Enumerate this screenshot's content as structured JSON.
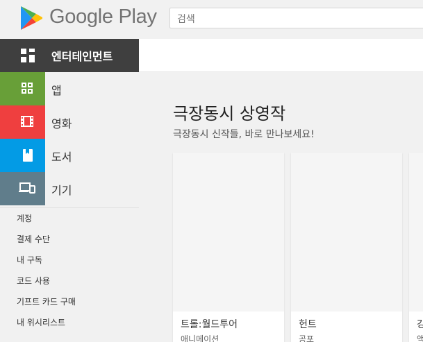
{
  "header": {
    "logo_text": "Google Play",
    "search_placeholder": "검색"
  },
  "sidebar": {
    "main": {
      "label": "엔터테인먼트",
      "icon": "entertainment-grid-icon"
    },
    "categories": [
      {
        "label": "앱",
        "icon": "apps-icon",
        "color": "#689f38"
      },
      {
        "label": "영화",
        "icon": "film-icon",
        "color": "#ef3f3f"
      },
      {
        "label": "도서",
        "icon": "book-icon",
        "color": "#039be5"
      },
      {
        "label": "기기",
        "icon": "devices-icon",
        "color": "#607d8b"
      }
    ],
    "links": [
      {
        "label": "계정"
      },
      {
        "label": "결제 수단"
      },
      {
        "label": "내 구독"
      },
      {
        "label": "코드 사용"
      },
      {
        "label": "기프트 카드 구매"
      },
      {
        "label": "내 위시리스트"
      }
    ]
  },
  "section": {
    "title": "극장동시 상영작",
    "subtitle": "극장동시 신작들, 바로 만나보세요!"
  },
  "cards": [
    {
      "title": "트롤:월드투어",
      "genre": "애니메이션"
    },
    {
      "title": "헌트",
      "genre": "공포"
    },
    {
      "title": "강",
      "genre": "액"
    }
  ]
}
